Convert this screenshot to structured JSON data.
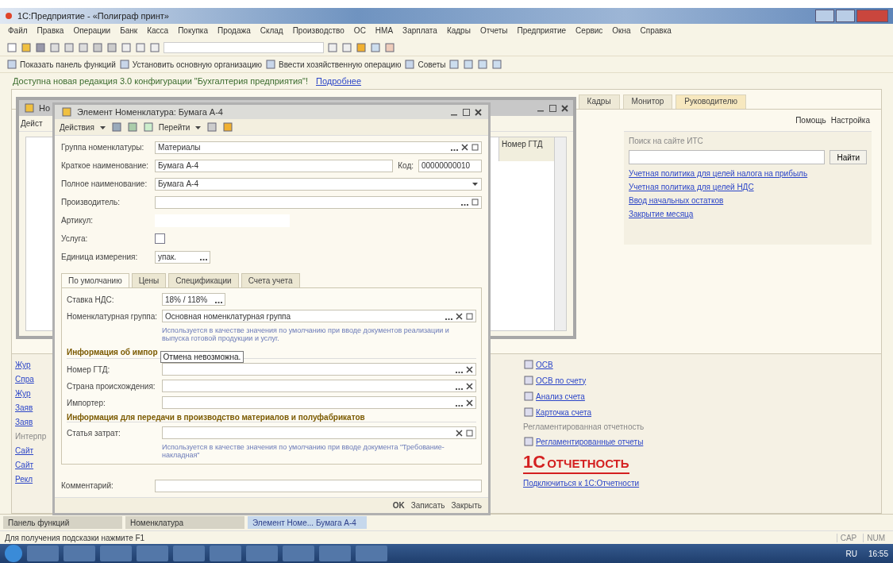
{
  "window": {
    "title": "1С:Предприятие - «Полиграф принт»"
  },
  "menu": [
    "Файл",
    "Правка",
    "Операции",
    "Банк",
    "Касса",
    "Покупка",
    "Продажа",
    "Склад",
    "Производство",
    "ОС",
    "НМА",
    "Зарплата",
    "Кадры",
    "Отчеты",
    "Предприятие",
    "Сервис",
    "Окна",
    "Справка"
  ],
  "toolbar_actions": [
    "Показать панель функций",
    "Установить основную организацию",
    "Ввести хозяйственную операцию",
    "Советы"
  ],
  "notice": {
    "text": "Доступна новая редакция 3.0 конфигурации \"Бухгалтерия предприятия\"!",
    "link": "Подробнее"
  },
  "panel": {
    "tabs": [
      {
        "label": "Кадры",
        "selected": false
      },
      {
        "label": "Монитор",
        "selected": false
      },
      {
        "label": "Руководителю",
        "selected": true
      }
    ],
    "header_buttons": [
      "Помощь",
      "Настройка"
    ],
    "search": {
      "label": "Поиск на сайте ИТС",
      "button": "Найти"
    },
    "links": [
      "Учетная политика для целей налога на прибыль",
      "Учетная политика для целей НДС",
      "Ввод начальных остатков",
      "Закрытие месяца"
    ],
    "side_links": [
      "Жур",
      "Спра",
      "Жур",
      "Заяв",
      "Заяв"
    ],
    "side_heading": "Интерпр",
    "side_links_2": [
      "Сайт",
      "Сайт",
      "Рекл"
    ],
    "reports": [
      "ОСВ",
      "ОСВ по счету",
      "Анализ счета",
      "Карточка счета"
    ],
    "reports_heading": "Регламентированная отчетность",
    "reg_link": "Регламентированные отчеты",
    "logo": {
      "mark": "1С",
      "word": "ОТЧЕТНОСТЬ"
    },
    "connect_link": "Подключиться к 1С:Отчетности"
  },
  "back_window": {
    "title": "Но",
    "actions": "Дейст",
    "column": "Номер ГТД"
  },
  "dialog": {
    "title": "Элемент Номенклатура: Бумага А-4",
    "actions": "Действия",
    "goto": "Перейти",
    "fields": [
      {
        "label": "Группа номенклатуры:",
        "value": "Материалы",
        "kind": "select"
      },
      {
        "label": "Краткое наименование:",
        "value": "Бумага А-4",
        "kind": "code",
        "code_label": "Код:",
        "code": "00000000010"
      },
      {
        "label": "Полное наименование:",
        "value": "Бумага А-4",
        "kind": "dropdown"
      },
      {
        "label": "Производитель:",
        "kind": "pick"
      },
      {
        "label": "Артикул:",
        "kind": "plain"
      },
      {
        "label": "Услуга:",
        "kind": "check",
        "checked": false
      },
      {
        "label": "Единица измерения:",
        "value": "упак.",
        "kind": "short"
      }
    ],
    "tabs": [
      {
        "label": "По умолчанию",
        "selected": true
      },
      {
        "label": "Цены",
        "selected": false
      },
      {
        "label": "Спецификации",
        "selected": false
      },
      {
        "label": "Счета учета",
        "selected": false
      }
    ],
    "vat": {
      "label": "Ставка НДС:",
      "value": "18% / 118%"
    },
    "group": {
      "label": "Номенклатурная группа:",
      "value": "Основная номенклатурная группа",
      "hint": "Используется в качестве значения по умолчанию при вводе документов реализации и выпуска готовой продукции и услуг."
    },
    "import_heading": "Информация об импор",
    "tooltip": "Отмена невозможна.",
    "import_fields": [
      "Номер ГТД:",
      "Страна происхождения:",
      "Импортер:"
    ],
    "production_heading": "Информация для передачи в производство материалов и полуфабрикатов",
    "cost": {
      "label": "Статья затрат:",
      "hint": "Используется в качестве значения по умолчанию при вводе документа \"Требование-накладная\""
    },
    "comment": "Комментарий:",
    "buttons": [
      "OK",
      "Записать",
      "Закрыть"
    ]
  },
  "window_tabs": [
    {
      "label": "Панель функций",
      "selected": false
    },
    {
      "label": "Номенклатура",
      "selected": false
    },
    {
      "label": "Элемент Номе... Бумага А-4",
      "selected": true
    }
  ],
  "status": {
    "text": "Для получения подсказки нажмите F1",
    "indicators": [
      "CAP",
      "NUM"
    ]
  },
  "taskbar": {
    "lang": "RU",
    "time": "16:55"
  }
}
